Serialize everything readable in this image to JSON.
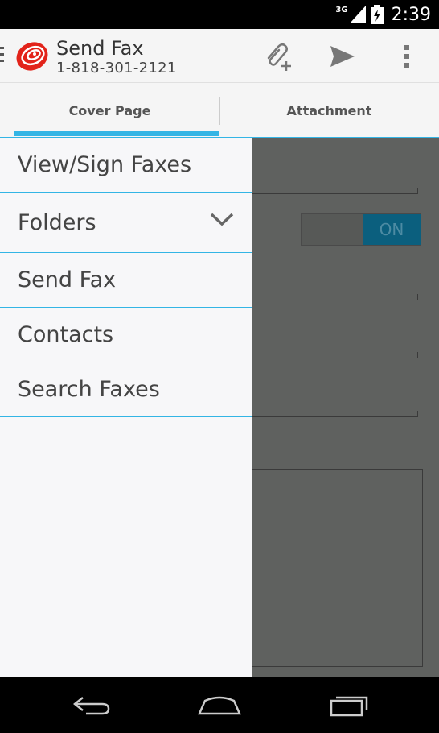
{
  "status_bar": {
    "network": "3G",
    "time": "2:39"
  },
  "app": {
    "title": "Send Fax",
    "subtitle": "1-818-301-2121",
    "accent_color": "#33b5e5",
    "logo_color": "#e2231a"
  },
  "action_bar": {
    "icons": [
      "attach-icon",
      "send-icon",
      "overflow-menu-icon"
    ]
  },
  "tabs": [
    {
      "label": "Cover Page",
      "selected": true
    },
    {
      "label": "Attachment",
      "selected": false
    }
  ],
  "background_form": {
    "toggle_label": "ON"
  },
  "drawer": {
    "items": [
      {
        "label": "View/Sign Faxes"
      },
      {
        "label": "Folders",
        "expandable": true
      },
      {
        "label": "Send Fax"
      },
      {
        "label": "Contacts"
      },
      {
        "label": "Search Faxes"
      }
    ]
  },
  "nav_bar": {
    "icons": [
      "back-icon",
      "home-icon",
      "recent-apps-icon"
    ]
  }
}
